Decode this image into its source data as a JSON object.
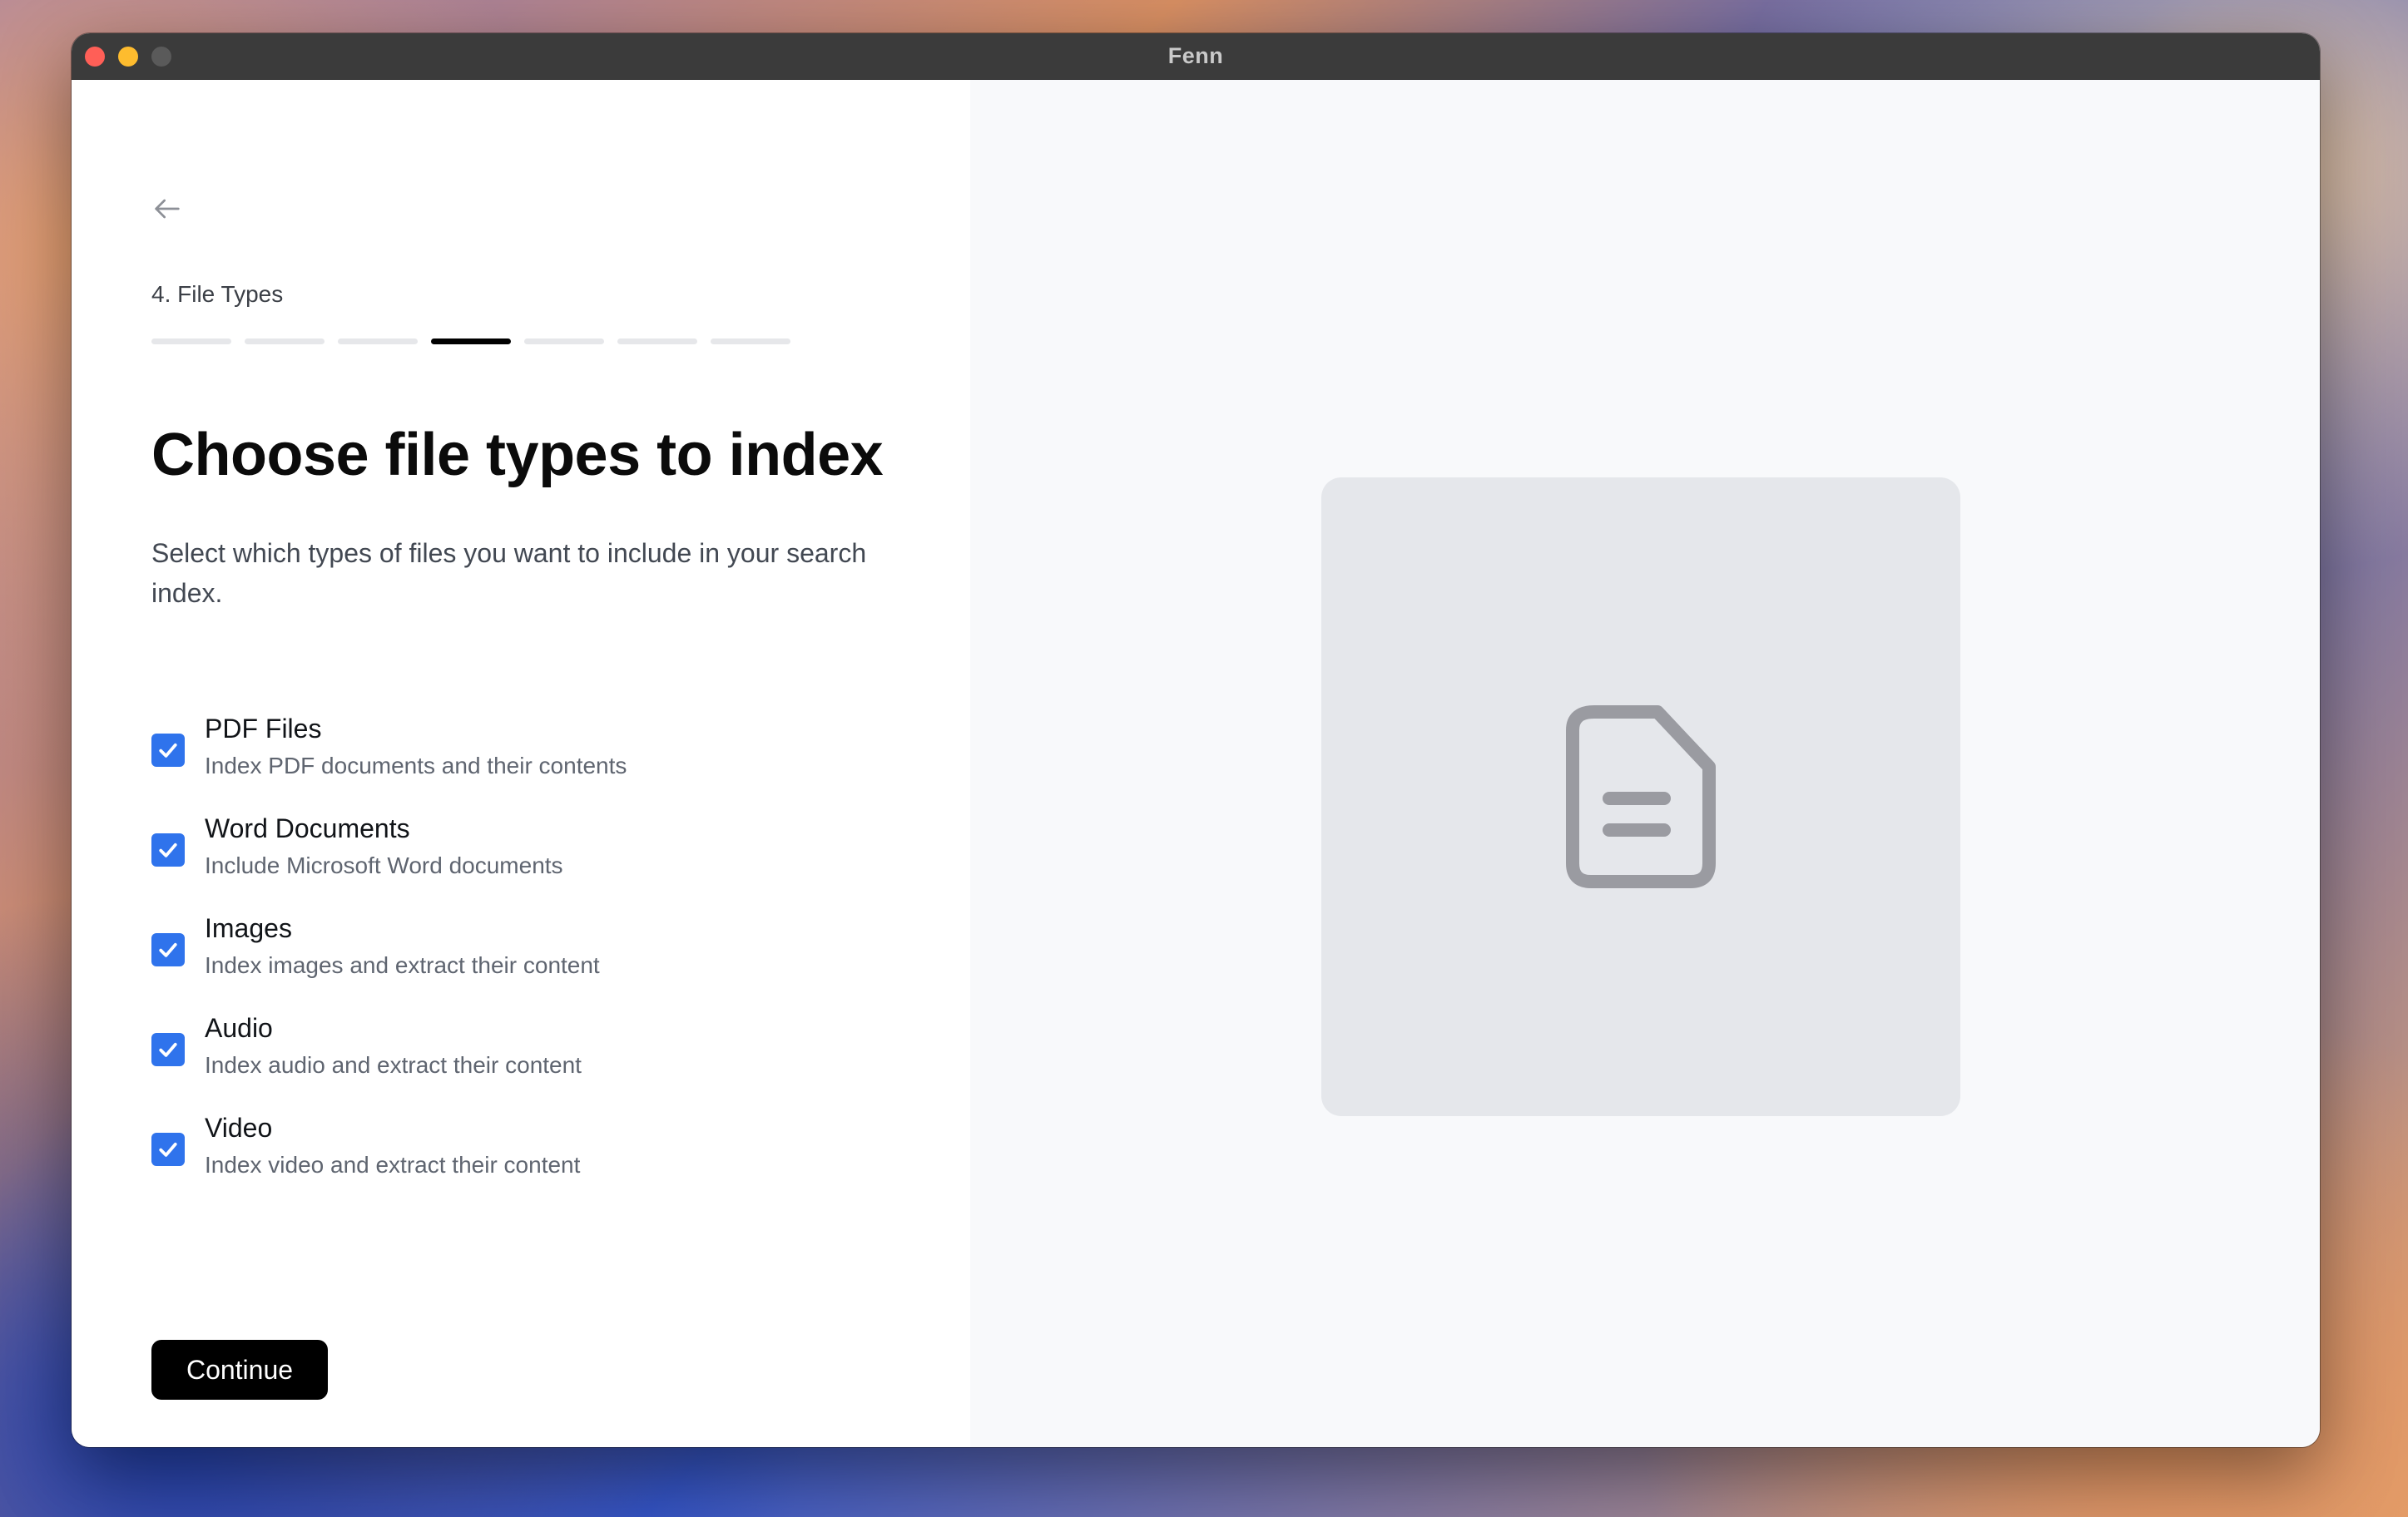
{
  "window": {
    "title": "Fenn"
  },
  "onboarding": {
    "step_label": "4. File Types",
    "total_steps": 7,
    "current_step": 4,
    "heading": "Choose file types to index",
    "subtitle": "Select which types of files you want to include in your search index.",
    "options": [
      {
        "title": "PDF Files",
        "description": "Index PDF documents and their contents",
        "checked": true
      },
      {
        "title": "Word Documents",
        "description": "Include Microsoft Word documents",
        "checked": true
      },
      {
        "title": "Images",
        "description": "Index images and extract their content",
        "checked": true
      },
      {
        "title": "Audio",
        "description": "Index audio and extract their content",
        "checked": true
      },
      {
        "title": "Video",
        "description": "Index video and extract their content",
        "checked": true
      }
    ],
    "continue_label": "Continue"
  },
  "preview": {
    "icon": "document-icon"
  },
  "colors": {
    "accent": "#2f73ec",
    "primary_button": "#000000",
    "preview_background": "#e5e7eb",
    "preview_icon": "#9a9ba1"
  }
}
